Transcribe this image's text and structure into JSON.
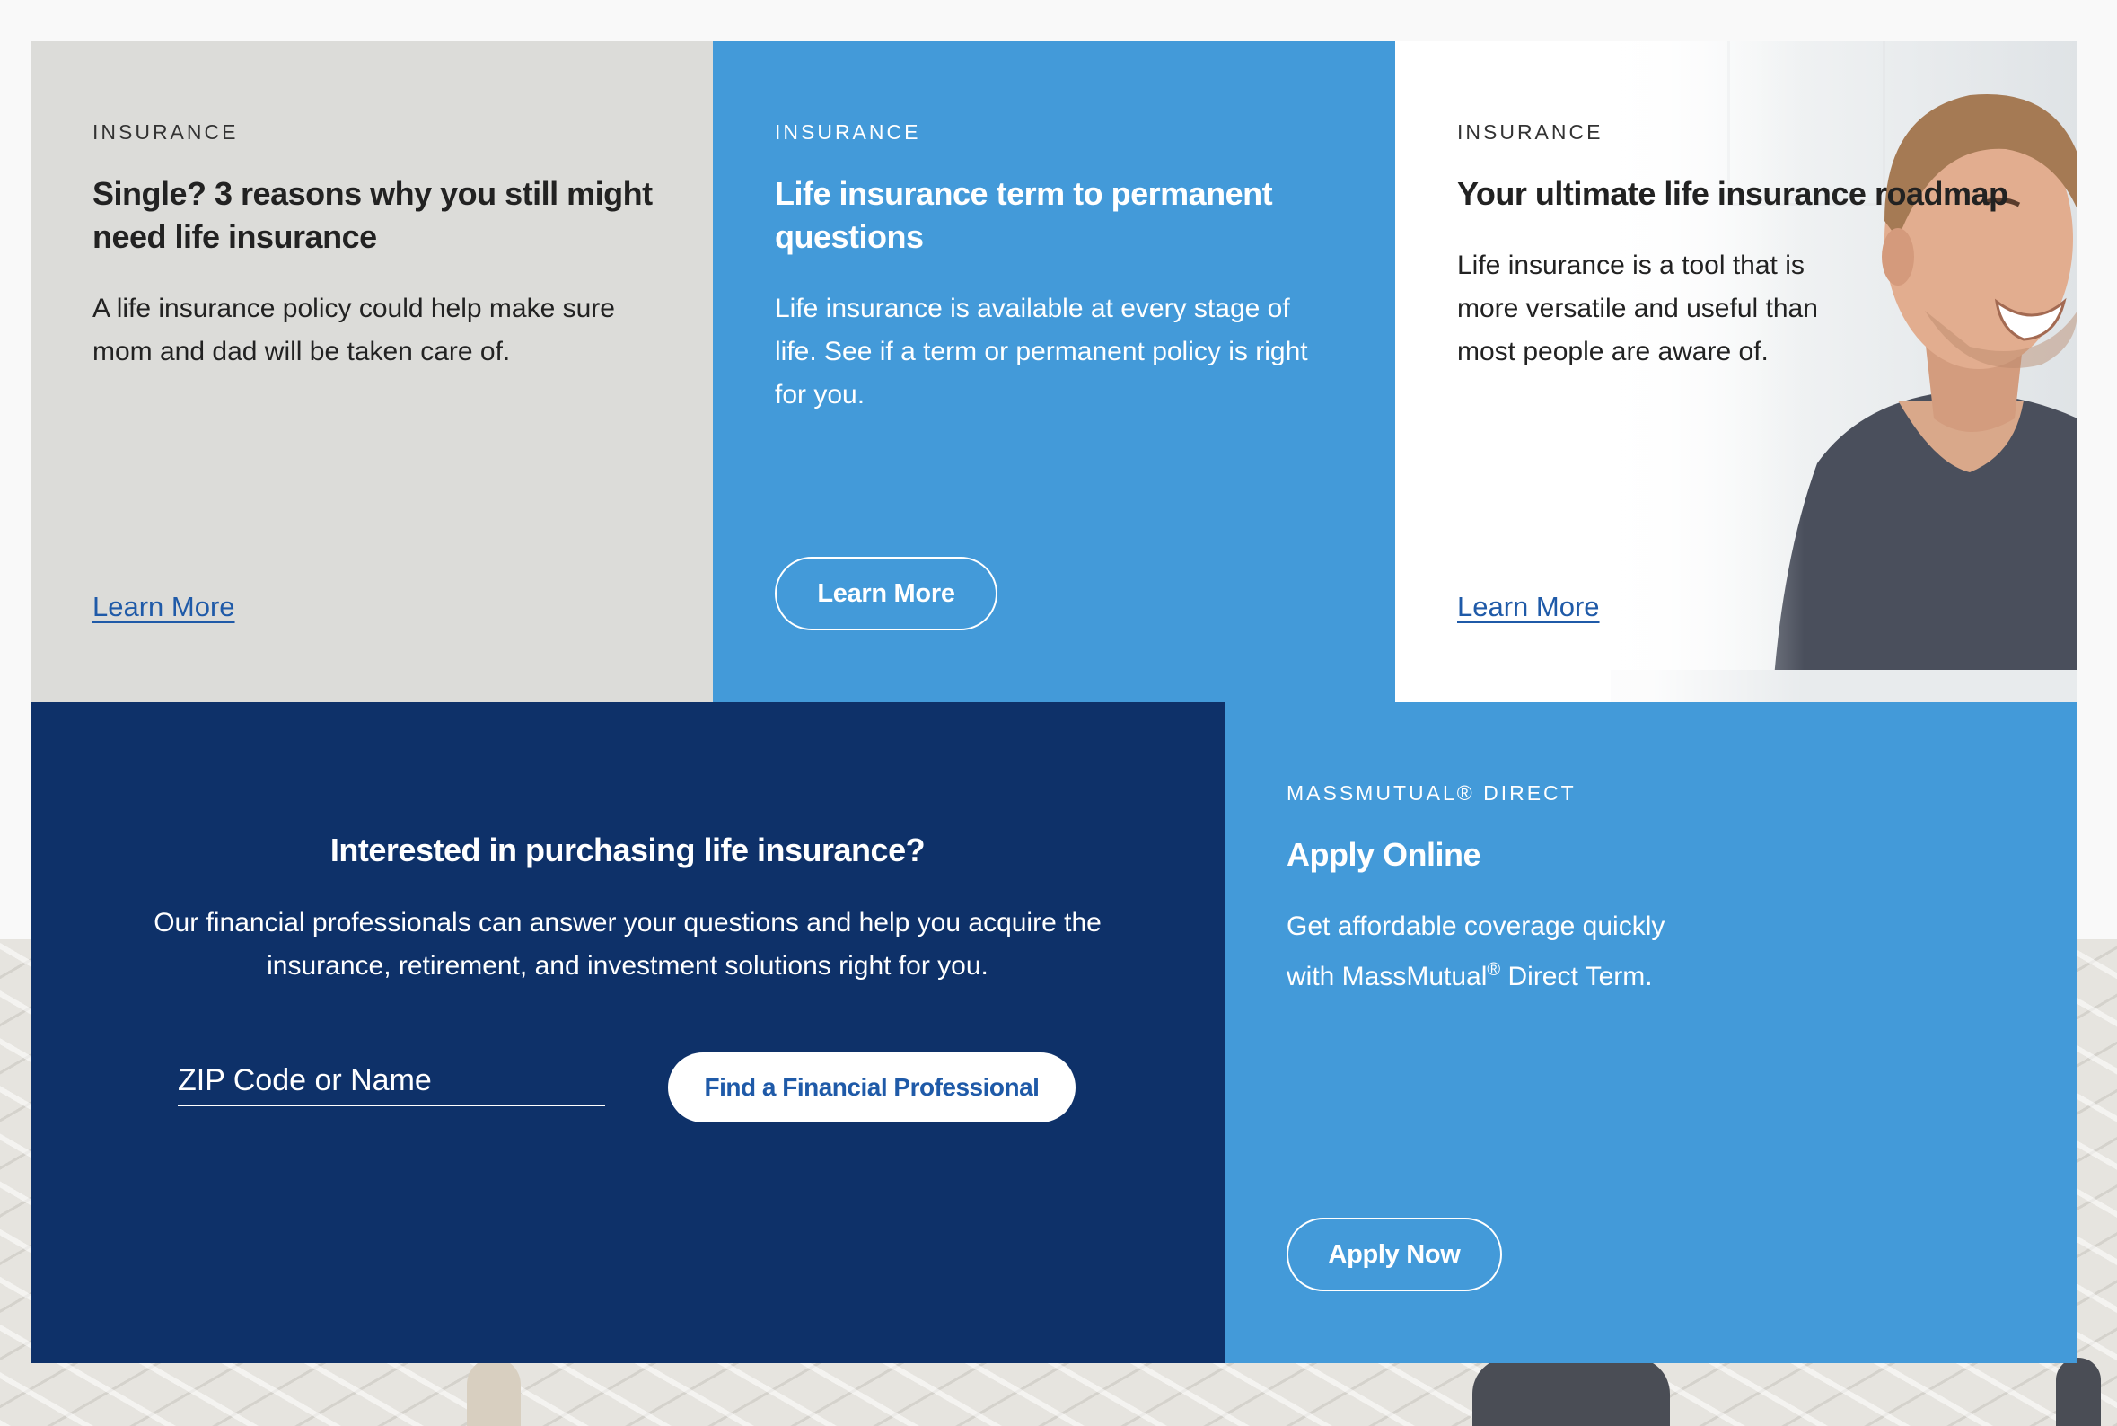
{
  "cards": [
    {
      "eyebrow": "INSURANCE",
      "title": "Single? 3 reasons why you still might need life insurance",
      "description": "A life insurance policy could help make sure mom and dad will be taken care of.",
      "link_label": "Learn More"
    },
    {
      "eyebrow": "INSURANCE",
      "title": "Life insurance term to permanent questions",
      "description": "Life insurance is available at every stage of life. See if a term or permanent policy is right for you.",
      "button_label": "Learn More"
    },
    {
      "eyebrow": "INSURANCE",
      "title": "Your ultimate life insurance roadmap",
      "description": "Life insurance is a tool that is more versatile and useful than most people are aware of.",
      "link_label": "Learn More"
    }
  ],
  "find_professional": {
    "heading": "Interested in purchasing life insurance?",
    "description": "Our financial professionals can answer your questions and help you acquire the insurance, retirement, and investment solutions right for you.",
    "input_placeholder": "ZIP Code or Name",
    "button_label": "Find a Financial Professional"
  },
  "apply_online": {
    "eyebrow": "MASSMUTUAL® DIRECT",
    "title": "Apply Online",
    "description_line1": "Get affordable coverage quickly",
    "description_line2_prefix": "with MassMutual",
    "description_line2_sup": "®",
    "description_line2_suffix": " Direct Term.",
    "button_label": "Apply Now"
  },
  "colors": {
    "light_gray_card": "#dcdcd9",
    "light_blue_card": "#439ad9",
    "navy_card": "#0e3169",
    "link_blue": "#1f5aa8",
    "dark_text": "#222222"
  }
}
